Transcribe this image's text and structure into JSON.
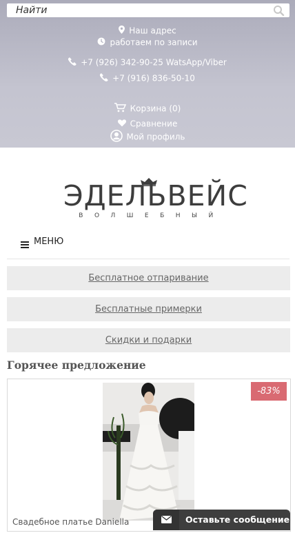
{
  "search": {
    "placeholder": "Найти"
  },
  "contacts": {
    "address": "Наш адрес",
    "schedule": "работаем по записи",
    "phone1": "+7 (926) 342-90-25 WatsApp/Viber",
    "phone2": "+7 (916) 836-50-10"
  },
  "user_links": {
    "cart": "Корзина (0)",
    "compare": "Сравнение",
    "profile": "Мой профиль"
  },
  "logo": {
    "main": "ЭДЕЛЬВЕЙС",
    "sub": "ВОЛШЕБНЫЙ"
  },
  "menu": {
    "label": "МЕНЮ"
  },
  "promos": [
    "Бесплатное отпаривание",
    "Бесплатные примерки",
    "Скидки и подарки"
  ],
  "hot_offer": {
    "title": "Горячее предложение",
    "discount": "-83%",
    "product_name": "Свадебное платье Daniella"
  },
  "chat": {
    "label": "Оставьте сообщение"
  },
  "colors": {
    "header_gradient_top": "#ababba",
    "header_gradient_bottom": "#c8c8d3",
    "promo_bg": "#ececec",
    "discount_badge": "#d96a72",
    "chat_bg": "#3e3e3e"
  },
  "icons": [
    "search-icon",
    "map-pin-icon",
    "clock-icon",
    "phone-icon",
    "cart-icon",
    "heart-icon",
    "user-icon",
    "hamburger-icon",
    "envelope-icon",
    "crown-icon"
  ]
}
